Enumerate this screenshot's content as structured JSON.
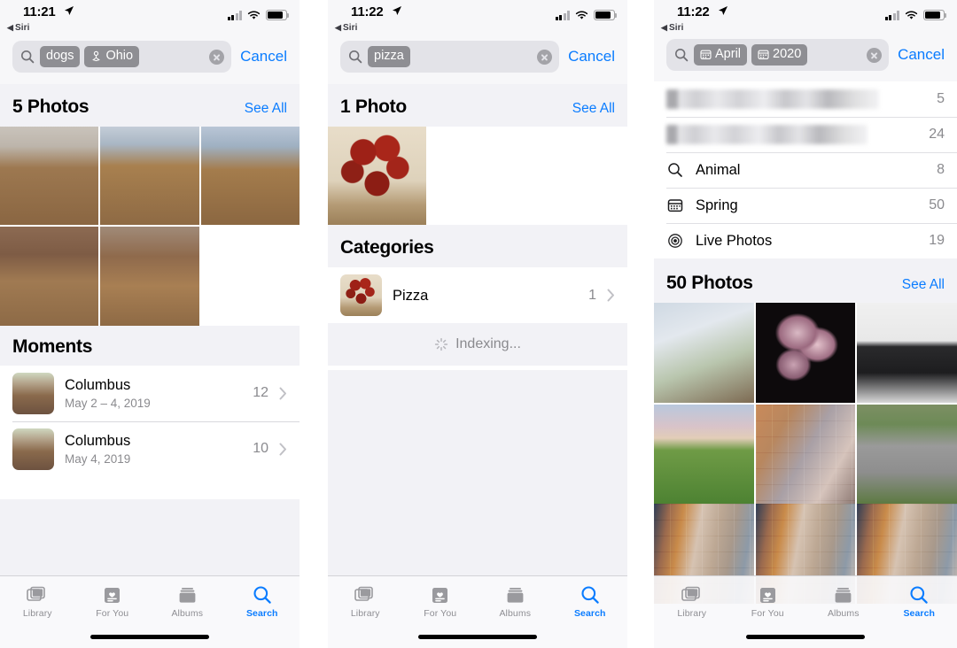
{
  "accent": "#0a7cff",
  "panels": [
    {
      "id": "panel-dogs-ohio",
      "status": {
        "time": "11:21",
        "back_label": "Siri",
        "location_arrow": "location-arrow-icon"
      },
      "search": {
        "icon": "search-icon",
        "tokens": [
          {
            "label": "dogs",
            "icon": null
          },
          {
            "label": "Ohio",
            "icon": "location-pin-icon"
          }
        ],
        "clear_label": "clear-icon",
        "cancel_label": "Cancel"
      },
      "sections": [
        {
          "type": "photos",
          "title": "5 Photos",
          "see_all": "See All",
          "count": 5
        },
        {
          "type": "moments",
          "title": "Moments"
        }
      ],
      "moments": [
        {
          "title": "Columbus",
          "subtitle": "May 2 – 4, 2019",
          "count": "12"
        },
        {
          "title": "Columbus",
          "subtitle": "May 4, 2019",
          "count": "10"
        }
      ],
      "tabs": [
        {
          "label": "Library",
          "icon": "photo-stack-icon",
          "active": false
        },
        {
          "label": "For You",
          "icon": "for-you-icon",
          "active": false
        },
        {
          "label": "Albums",
          "icon": "albums-icon",
          "active": false
        },
        {
          "label": "Search",
          "icon": "search-icon",
          "active": true
        }
      ]
    },
    {
      "id": "panel-pizza",
      "status": {
        "time": "11:22",
        "back_label": "Siri",
        "location_arrow": "location-arrow-icon"
      },
      "search": {
        "icon": "search-icon",
        "tokens": [
          {
            "label": "pizza",
            "icon": null
          }
        ],
        "clear_label": "clear-icon",
        "cancel_label": "Cancel"
      },
      "sections": [
        {
          "type": "photos",
          "title": "1 Photo",
          "see_all": "See All",
          "count": 1
        },
        {
          "type": "categories",
          "title": "Categories"
        }
      ],
      "categories": [
        {
          "title": "Pizza",
          "count": "1"
        }
      ],
      "indexing_label": "Indexing...",
      "tabs": [
        {
          "label": "Library",
          "icon": "photo-stack-icon",
          "active": false
        },
        {
          "label": "For You",
          "icon": "for-you-icon",
          "active": false
        },
        {
          "label": "Albums",
          "icon": "albums-icon",
          "active": false
        },
        {
          "label": "Search",
          "icon": "search-icon",
          "active": true
        }
      ]
    },
    {
      "id": "panel-april-2020",
      "status": {
        "time": "11:22",
        "back_label": "Siri",
        "location_arrow": "location-arrow-icon"
      },
      "search": {
        "icon": "search-icon",
        "tokens": [
          {
            "label": "April",
            "icon": "calendar-icon"
          },
          {
            "label": "2020",
            "icon": "calendar-icon"
          }
        ],
        "clear_label": "clear-icon",
        "cancel_label": "Cancel"
      },
      "suggestions": [
        {
          "label": "",
          "redacted": true,
          "count": "5",
          "icon": null
        },
        {
          "label": "",
          "redacted": true,
          "count": "24",
          "icon": null
        },
        {
          "label": "Animal",
          "redacted": false,
          "count": "8",
          "icon": "search-icon"
        },
        {
          "label": "Spring",
          "redacted": false,
          "count": "50",
          "icon": "calendar-icon"
        },
        {
          "label": "Live Photos",
          "redacted": false,
          "count": "19",
          "icon": "live-photos-icon"
        }
      ],
      "sections": [
        {
          "type": "photos",
          "title": "50 Photos",
          "see_all": "See All",
          "count": 50
        }
      ],
      "tabs": [
        {
          "label": "Library",
          "icon": "photo-stack-icon",
          "active": false
        },
        {
          "label": "For You",
          "icon": "for-you-icon",
          "active": false
        },
        {
          "label": "Albums",
          "icon": "albums-icon",
          "active": false
        },
        {
          "label": "Search",
          "icon": "search-icon",
          "active": true
        }
      ]
    }
  ]
}
